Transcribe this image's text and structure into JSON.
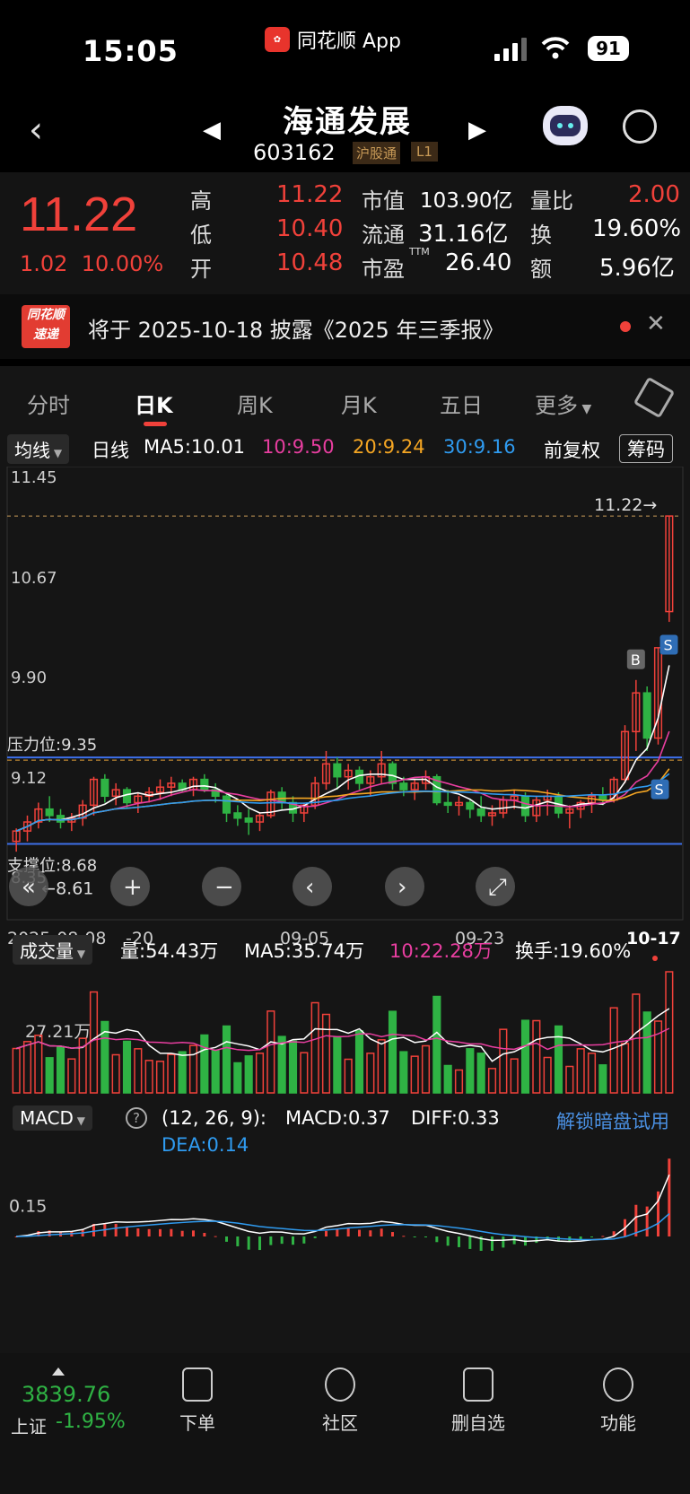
{
  "status": {
    "time": "15:05",
    "app": "同花顺 App",
    "battery": "91"
  },
  "header": {
    "name": "海通发展",
    "code": "603162",
    "tag_market": "沪股通",
    "tag_level": "L1"
  },
  "quote": {
    "price": "11.22",
    "change": "1.02",
    "change_pct": "10.00%",
    "high_label": "高",
    "high": "11.22",
    "low_label": "低",
    "low": "10.40",
    "open_label": "开",
    "open": "10.48",
    "mcap_label": "市值",
    "mcap": "103.90亿",
    "float_label": "流通",
    "float": "31.16亿",
    "pe_label": "市盈",
    "pe_sup": "TTM",
    "pe": "26.40",
    "vr_label": "量比",
    "vr": "2.00",
    "turn_label": "换",
    "turn": "19.60%",
    "amt_label": "额",
    "amt": "5.96亿"
  },
  "notice": {
    "logo_top": "同花顺",
    "logo_bottom": "速递",
    "text": "将于 2025-10-18 披露《2025 年三季报》"
  },
  "tabs": [
    "分时",
    "日K",
    "周K",
    "月K",
    "五日",
    "更多"
  ],
  "ma": {
    "select": "均线",
    "period": "日线",
    "ma5": "MA5:10.01",
    "ma10": "10:9.50",
    "ma20": "20:9.24",
    "ma30": "30:9.16",
    "adjust": "前复权",
    "chip": "筹码"
  },
  "kline": {
    "y_labels": [
      "11.45",
      "10.67",
      "9.90",
      "9.12",
      "8.35"
    ],
    "last_price_label": "11.22→",
    "pressure": "压力位:9.35",
    "support": "支撑位:8.68",
    "min_label": "←8.61",
    "x_labels": [
      "2025-08-08",
      "-20",
      "09-05",
      "09-23",
      "10-17"
    ],
    "buy_mark": "B",
    "sell_mark": "S"
  },
  "volume": {
    "select": "成交量",
    "vol": "量:54.43万",
    "ma5": "MA5:35.74万",
    "ma10": "10:22.28万",
    "turnover": "换手:19.60%",
    "y_label": "27.21万"
  },
  "macd": {
    "select": "MACD",
    "params": "(12, 26, 9):",
    "macd": "MACD:0.37",
    "diff": "DIFF:0.33",
    "dea": "DEA:0.14",
    "unlock": "解锁暗盘试用",
    "y_label": "0.15"
  },
  "index": {
    "value": "3839.76",
    "name": "上证",
    "change": "-1.95%"
  },
  "nav": [
    "下单",
    "社区",
    "删自选",
    "功能"
  ],
  "colors": {
    "up": "#f0413a",
    "down": "#2fb344",
    "ma5": "#ffffff",
    "ma10": "#e83ea0",
    "ma20": "#f5a623",
    "ma30": "#2f9bf0"
  },
  "chart_data": {
    "type": "candlestick",
    "candles": [
      [
        8.7,
        8.8,
        8.62,
        8.78
      ],
      [
        8.78,
        8.9,
        8.7,
        8.85
      ],
      [
        8.85,
        9.0,
        8.8,
        8.95
      ],
      [
        8.95,
        9.05,
        8.85,
        8.9
      ],
      [
        8.9,
        8.95,
        8.8,
        8.85
      ],
      [
        8.85,
        8.92,
        8.78,
        8.88
      ],
      [
        8.88,
        9.02,
        8.82,
        8.98
      ],
      [
        8.98,
        9.2,
        8.9,
        9.18
      ],
      [
        9.18,
        9.22,
        9.0,
        9.05
      ],
      [
        9.05,
        9.15,
        8.98,
        9.1
      ],
      [
        9.1,
        9.12,
        8.95,
        9.0
      ],
      [
        9.0,
        9.08,
        8.92,
        9.05
      ],
      [
        9.05,
        9.12,
        9.0,
        9.08
      ],
      [
        9.08,
        9.18,
        9.02,
        9.12
      ],
      [
        9.12,
        9.2,
        9.05,
        9.15
      ],
      [
        9.15,
        9.18,
        9.08,
        9.1
      ],
      [
        9.1,
        9.2,
        9.05,
        9.18
      ],
      [
        9.18,
        9.22,
        9.08,
        9.1
      ],
      [
        9.1,
        9.15,
        9.0,
        9.05
      ],
      [
        9.05,
        9.08,
        8.85,
        8.92
      ],
      [
        8.92,
        8.98,
        8.82,
        8.88
      ],
      [
        8.88,
        8.95,
        8.75,
        8.85
      ],
      [
        8.85,
        8.92,
        8.78,
        8.9
      ],
      [
        8.9,
        9.1,
        8.88,
        9.08
      ],
      [
        9.08,
        9.12,
        8.95,
        9.0
      ],
      [
        9.0,
        9.05,
        8.85,
        8.92
      ],
      [
        8.92,
        9.0,
        8.85,
        8.98
      ],
      [
        8.98,
        9.2,
        8.95,
        9.15
      ],
      [
        9.15,
        9.4,
        9.1,
        9.3
      ],
      [
        9.3,
        9.35,
        9.1,
        9.2
      ],
      [
        9.2,
        9.3,
        9.1,
        9.25
      ],
      [
        9.25,
        9.28,
        9.1,
        9.15
      ],
      [
        9.15,
        9.25,
        9.05,
        9.2
      ],
      [
        9.2,
        9.4,
        9.15,
        9.3
      ],
      [
        9.3,
        9.32,
        9.1,
        9.15
      ],
      [
        9.15,
        9.2,
        9.05,
        9.1
      ],
      [
        9.1,
        9.18,
        9.02,
        9.15
      ],
      [
        9.15,
        9.25,
        9.1,
        9.2
      ],
      [
        9.2,
        9.22,
        8.98,
        9.0
      ],
      [
        9.0,
        9.1,
        8.92,
        8.98
      ],
      [
        8.98,
        9.05,
        8.9,
        9.0
      ],
      [
        9.0,
        9.02,
        8.88,
        8.95
      ],
      [
        8.95,
        9.05,
        8.85,
        8.9
      ],
      [
        8.9,
        8.98,
        8.82,
        8.92
      ],
      [
        8.92,
        9.05,
        8.88,
        9.02
      ],
      [
        9.02,
        9.1,
        8.95,
        9.05
      ],
      [
        9.05,
        9.08,
        8.85,
        8.9
      ],
      [
        8.9,
        9.05,
        8.85,
        9.02
      ],
      [
        9.02,
        9.1,
        8.9,
        9.05
      ],
      [
        9.05,
        9.08,
        8.88,
        8.92
      ],
      [
        8.92,
        8.98,
        8.8,
        8.95
      ],
      [
        8.95,
        9.02,
        8.88,
        9.0
      ],
      [
        9.0,
        9.08,
        8.92,
        9.05
      ],
      [
        9.05,
        9.12,
        8.98,
        9.02
      ],
      [
        9.02,
        9.2,
        9.0,
        9.18
      ],
      [
        9.18,
        9.6,
        9.15,
        9.55
      ],
      [
        9.55,
        9.95,
        9.4,
        9.85
      ],
      [
        9.85,
        9.9,
        9.4,
        9.5
      ],
      [
        9.5,
        10.2,
        9.45,
        10.2
      ],
      [
        10.48,
        11.22,
        10.4,
        11.22
      ]
    ],
    "ma5_last": 10.01,
    "ma10_last": 9.5,
    "ma20_last": 9.24,
    "ma30_last": 9.16,
    "pressure": 9.35,
    "support": 8.68,
    "ylim": [
      8.35,
      11.45
    ],
    "volume_ma5_last": "35.74万",
    "volume_ma10_last": "22.28万",
    "volume_last": "54.43万",
    "macd_last": 0.37,
    "diff_last": 0.33,
    "dea_last": 0.14
  }
}
